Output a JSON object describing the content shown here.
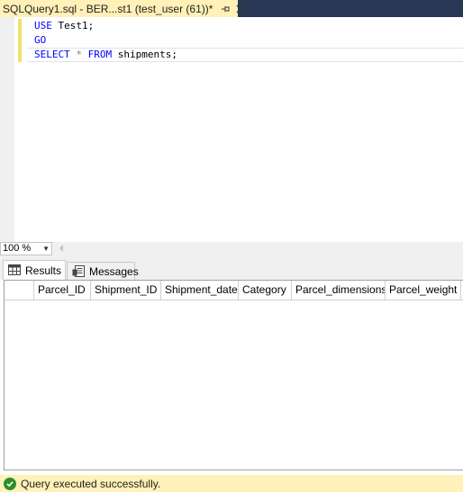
{
  "tab": {
    "title": "SQLQuery1.sql - BER...st1 (test_user (61))*",
    "pin_icon": "pin-icon",
    "close_icon": "close-icon"
  },
  "editor": {
    "lines": [
      {
        "kw1": "USE",
        "rest": " Test1;"
      },
      {
        "kw1": "GO"
      },
      {
        "kw1": "SELECT",
        "star": " * ",
        "kw2": "FROM",
        "rest": " shipments;"
      }
    ]
  },
  "zoom": {
    "value": "100 %"
  },
  "results_tabs": [
    {
      "label": "Results",
      "icon": "grid-icon"
    },
    {
      "label": "Messages",
      "icon": "messages-icon"
    }
  ],
  "grid": {
    "columns": [
      "Parcel_ID",
      "Shipment_ID",
      "Shipment_date",
      "Category",
      "Parcel_dimensions",
      "Parcel_weight"
    ],
    "rows": []
  },
  "status": {
    "text": "Query executed successfully.",
    "icon": "check-circle-icon"
  },
  "colors": {
    "tab_bg": "#fff1b8",
    "titlebar_bg": "#293955",
    "keyword": "#0000ff",
    "status_ok": "#2b8f2b"
  }
}
